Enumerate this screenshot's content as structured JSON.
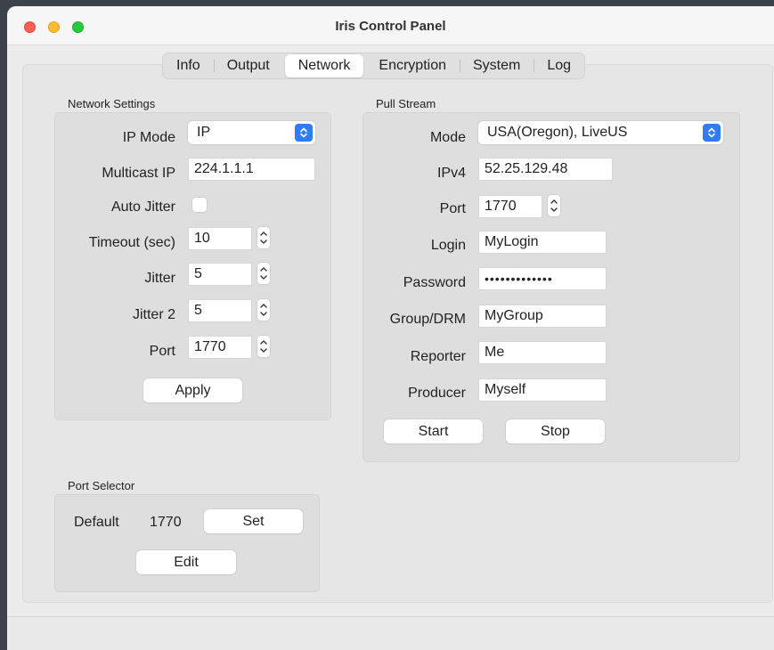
{
  "window": {
    "title": "Iris Control Panel"
  },
  "tabs": [
    {
      "label": "Info",
      "active": false
    },
    {
      "label": "Output",
      "active": false
    },
    {
      "label": "Network",
      "active": true
    },
    {
      "label": "Encryption",
      "active": false
    },
    {
      "label": "System",
      "active": false
    },
    {
      "label": "Log",
      "active": false
    }
  ],
  "network_settings": {
    "group_label": "Network Settings",
    "ip_mode_label": "IP Mode",
    "ip_mode_value": "IP",
    "multicast_ip_label": "Multicast IP",
    "multicast_ip_value": "224.1.1.1",
    "auto_jitter_label": "Auto Jitter",
    "auto_jitter_checked": false,
    "timeout_label": "Timeout (sec)",
    "timeout_value": "10",
    "jitter_label": "Jitter",
    "jitter_value": "5",
    "jitter2_label": "Jitter 2",
    "jitter2_value": "5",
    "port_label": "Port",
    "port_value": "1770",
    "apply_label": "Apply"
  },
  "pull_stream": {
    "group_label": "Pull Stream",
    "mode_label": "Mode",
    "mode_value": "USA(Oregon), LiveUS",
    "ipv4_label": "IPv4",
    "ipv4_value": "52.25.129.48",
    "port_label": "Port",
    "port_value": "1770",
    "login_label": "Login",
    "login_value": "MyLogin",
    "password_label": "Password",
    "password_value": "•••••••••••••",
    "group_drm_label": "Group/DRM",
    "group_drm_value": "MyGroup",
    "reporter_label": "Reporter",
    "reporter_value": "Me",
    "producer_label": "Producer",
    "producer_value": "Myself",
    "start_label": "Start",
    "stop_label": "Stop"
  },
  "port_selector": {
    "group_label": "Port Selector",
    "default_label": "Default",
    "default_value": "1770",
    "set_label": "Set",
    "edit_label": "Edit"
  },
  "colors": {
    "accent": "#2f7cf6",
    "close": "#fe5f57",
    "minimize": "#febc2e",
    "maximize": "#28c840"
  }
}
